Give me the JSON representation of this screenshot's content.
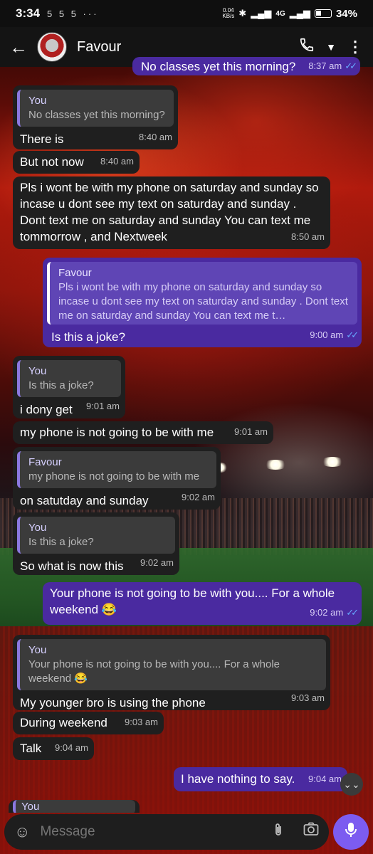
{
  "status_bar": {
    "time": "3:34",
    "notifications": "5 5 5 ···",
    "net_speed_value": "0.04",
    "net_speed_unit": "KB/s",
    "network": "4G",
    "battery": "34%"
  },
  "header": {
    "contact_name": "Favour"
  },
  "messages": [
    {
      "dir": "out",
      "text": "No classes yet this morning?",
      "time": "8:37 am"
    },
    {
      "dir": "in",
      "quote_author": "You",
      "quote_text": "No classes yet this morning?",
      "text": "There is",
      "time": "8:40 am"
    },
    {
      "dir": "in",
      "text": "But not now",
      "time": "8:40 am"
    },
    {
      "dir": "in",
      "text": "Pls i wont be with my phone on saturday and sunday so incase u dont see my text on saturday and sunday . Dont text me on saturday and sunday You can text me tommorrow , and Nextweek",
      "time": "8:50 am"
    },
    {
      "dir": "out",
      "quote_author": "Favour",
      "quote_text": "Pls i wont be with my phone on saturday and sunday so incase u dont see my text on saturday and sunday . Dont text me on saturday and sunday You can text me t…",
      "text": "Is this a joke?",
      "time": "9:00 am"
    },
    {
      "dir": "in",
      "quote_author": "You",
      "quote_text": "Is this a joke?",
      "text": "i dony get",
      "time": "9:01 am"
    },
    {
      "dir": "in",
      "text": "my phone is not going to be with me",
      "time": "9:01 am"
    },
    {
      "dir": "in",
      "quote_author": "Favour",
      "quote_text": "my phone is not going to be with me",
      "text": "on satutday and sunday",
      "time": "9:02 am"
    },
    {
      "dir": "in",
      "quote_author": "You",
      "quote_text": "Is this a joke?",
      "text": "So what is now this",
      "time": "9:02 am"
    },
    {
      "dir": "out",
      "text": "Your phone is not going to be with you.... For a whole weekend 😂",
      "time": "9:02 am"
    },
    {
      "dir": "in",
      "quote_author": "You",
      "quote_text": "Your phone is not going to be with you.... For a whole weekend 😂",
      "text": "My younger bro is using the phone",
      "time": "9:03 am"
    },
    {
      "dir": "in",
      "text": "During weekend",
      "time": "9:03 am"
    },
    {
      "dir": "in",
      "text": "Talk",
      "time": "9:04 am"
    },
    {
      "dir": "out",
      "text": "I have nothing to say.",
      "time": "9:04 am"
    },
    {
      "dir": "in",
      "quote_author": "You",
      "text": "",
      "time": ""
    }
  ],
  "input": {
    "placeholder": "Message"
  },
  "icons": {
    "back": "arrow-left-icon",
    "call": "phone-icon",
    "dropdown": "caret-down-icon",
    "menu": "more-vertical-icon",
    "emoji": "sticker-icon",
    "attach": "paperclip-icon",
    "camera": "camera-icon",
    "mic": "mic-icon",
    "scroll": "double-chevron-down-icon"
  },
  "colors": {
    "outgoing_bubble": "#4a2aa0",
    "incoming_bubble": "#1f1f1f",
    "accent": "#7c5cf0",
    "read_ticks": "#66a8ff"
  }
}
